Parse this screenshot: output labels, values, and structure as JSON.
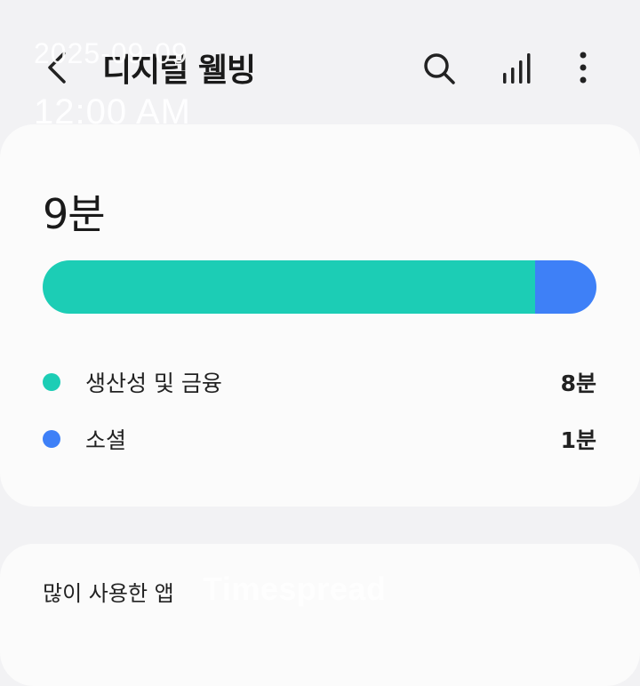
{
  "overlay": {
    "date": "2025-09-09",
    "time": "12:00 AM"
  },
  "header": {
    "title": "디지털 웰빙",
    "icons": {
      "back": "back-arrow-icon",
      "search": "search-icon",
      "stats": "bar-chart-icon",
      "more": "more-options-icon"
    }
  },
  "summary": {
    "total": "9분",
    "categories": [
      {
        "label": "생산성 및 금융",
        "value": "8분",
        "minutes": 8,
        "color": "#1ccdb5"
      },
      {
        "label": "소셜",
        "value": "1분",
        "minutes": 1,
        "color": "#3e80f7"
      }
    ]
  },
  "apps_section": {
    "heading": "많이 사용한 앱"
  },
  "watermark": "Timespread"
}
